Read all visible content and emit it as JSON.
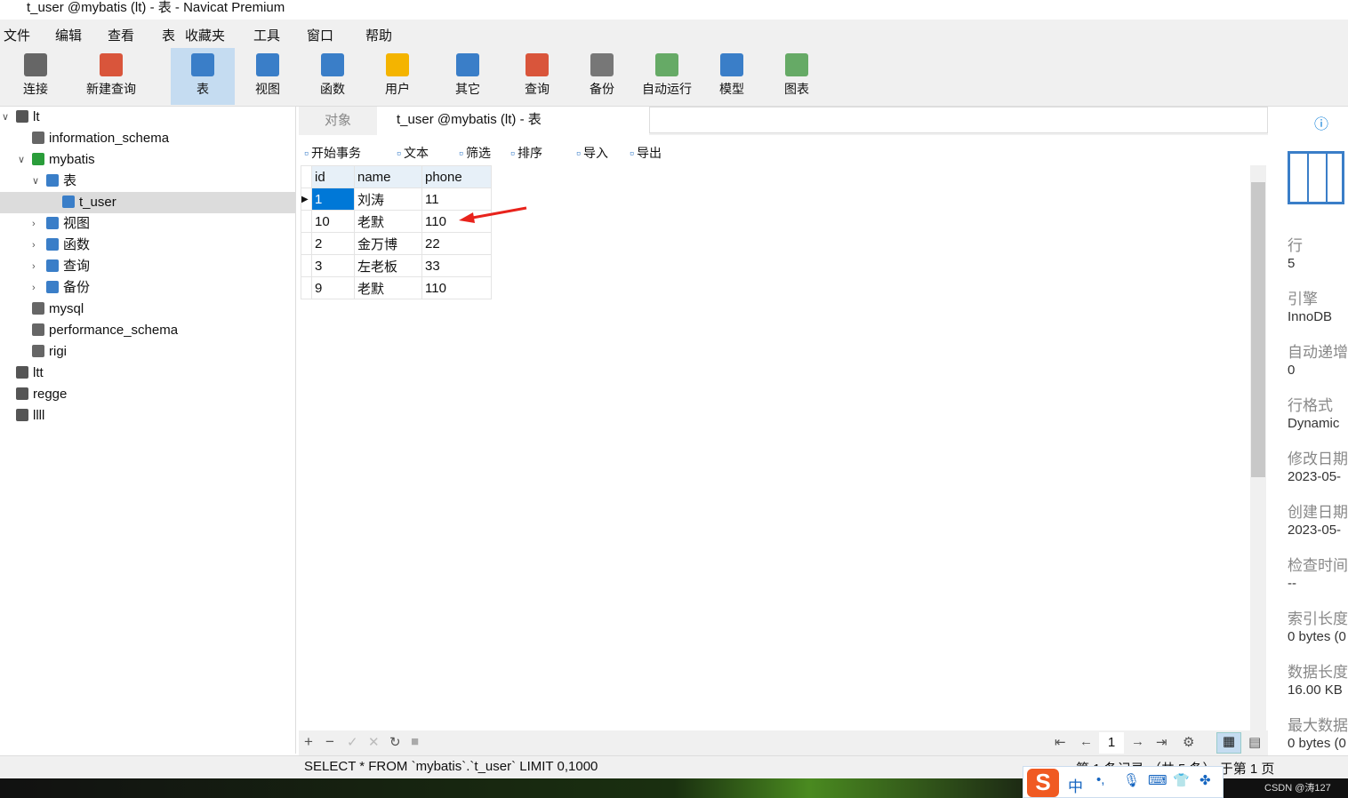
{
  "window": {
    "title": "t_user @mybatis (lt) - 表 - Navicat Premium"
  },
  "menu": [
    "文件",
    "编辑",
    "查看",
    "表",
    "收藏夹",
    "工具",
    "窗口",
    "帮助"
  ],
  "toolbar": [
    {
      "label": "连接",
      "icon": "connection-icon"
    },
    {
      "label": "新建查询",
      "icon": "new-query-icon"
    },
    {
      "label": "表",
      "icon": "table-icon",
      "active": true
    },
    {
      "label": "视图",
      "icon": "view-icon"
    },
    {
      "label": "函数",
      "icon": "function-icon"
    },
    {
      "label": "用户",
      "icon": "user-icon"
    },
    {
      "label": "其它",
      "icon": "tools-icon"
    },
    {
      "label": "查询",
      "icon": "query-icon"
    },
    {
      "label": "备份",
      "icon": "backup-icon"
    },
    {
      "label": "自动运行",
      "icon": "schedule-icon"
    },
    {
      "label": "模型",
      "icon": "model-icon"
    },
    {
      "label": "图表",
      "icon": "chart-icon"
    }
  ],
  "tree": [
    {
      "label": "lt",
      "level": 0
    },
    {
      "label": "information_schema",
      "level": 1
    },
    {
      "label": "mybatis",
      "level": 1
    },
    {
      "label": "表",
      "level": 2
    },
    {
      "label": "t_user",
      "level": 3,
      "selected": true
    },
    {
      "label": "视图",
      "level": 2
    },
    {
      "label": "函数",
      "level": 2
    },
    {
      "label": "查询",
      "level": 2
    },
    {
      "label": "备份",
      "level": 2
    },
    {
      "label": "mysql",
      "level": 1
    },
    {
      "label": "performance_schema",
      "level": 1
    },
    {
      "label": "rigi",
      "level": 1
    },
    {
      "label": "ltt",
      "level": 0
    },
    {
      "label": "regge",
      "level": 0
    },
    {
      "label": "llll",
      "level": 0
    }
  ],
  "tabs": {
    "objects": "对象",
    "active": "t_user @mybatis (lt) - 表"
  },
  "subtoolbar": [
    "开始事务",
    "文本",
    "筛选",
    "排序",
    "导入",
    "导出"
  ],
  "table": {
    "columns": [
      "id",
      "name",
      "phone"
    ],
    "rows": [
      [
        "1",
        "刘涛",
        "11"
      ],
      [
        "10",
        "老默",
        "110"
      ],
      [
        "2",
        "金万博",
        "22"
      ],
      [
        "3",
        "左老板",
        "33"
      ],
      [
        "9",
        "老默",
        "110"
      ]
    ]
  },
  "pager": {
    "page": "1"
  },
  "status": {
    "sql": "SELECT * FROM `mybatis`.`t_user` LIMIT 0,1000",
    "record": "第 1 条记录 （共 5 条） 于第 1 页"
  },
  "info": [
    [
      "行",
      "5"
    ],
    [
      "引擎",
      "InnoDB"
    ],
    [
      "自动递增",
      "0"
    ],
    [
      "行格式",
      "Dynamic"
    ],
    [
      "修改日期",
      "2023-05-"
    ],
    [
      "创建日期",
      "2023-05-"
    ],
    [
      "检查时间",
      "--"
    ],
    [
      "索引长度",
      "0 bytes (0"
    ],
    [
      "数据长度",
      "16.00 KB"
    ],
    [
      "最大数据",
      "0 bytes (0"
    ]
  ],
  "ime": {
    "mode": "中"
  },
  "watermark": "CSDN @涛127",
  "colors": {
    "accent": "#0078d7",
    "arrow": "#e8231c"
  }
}
